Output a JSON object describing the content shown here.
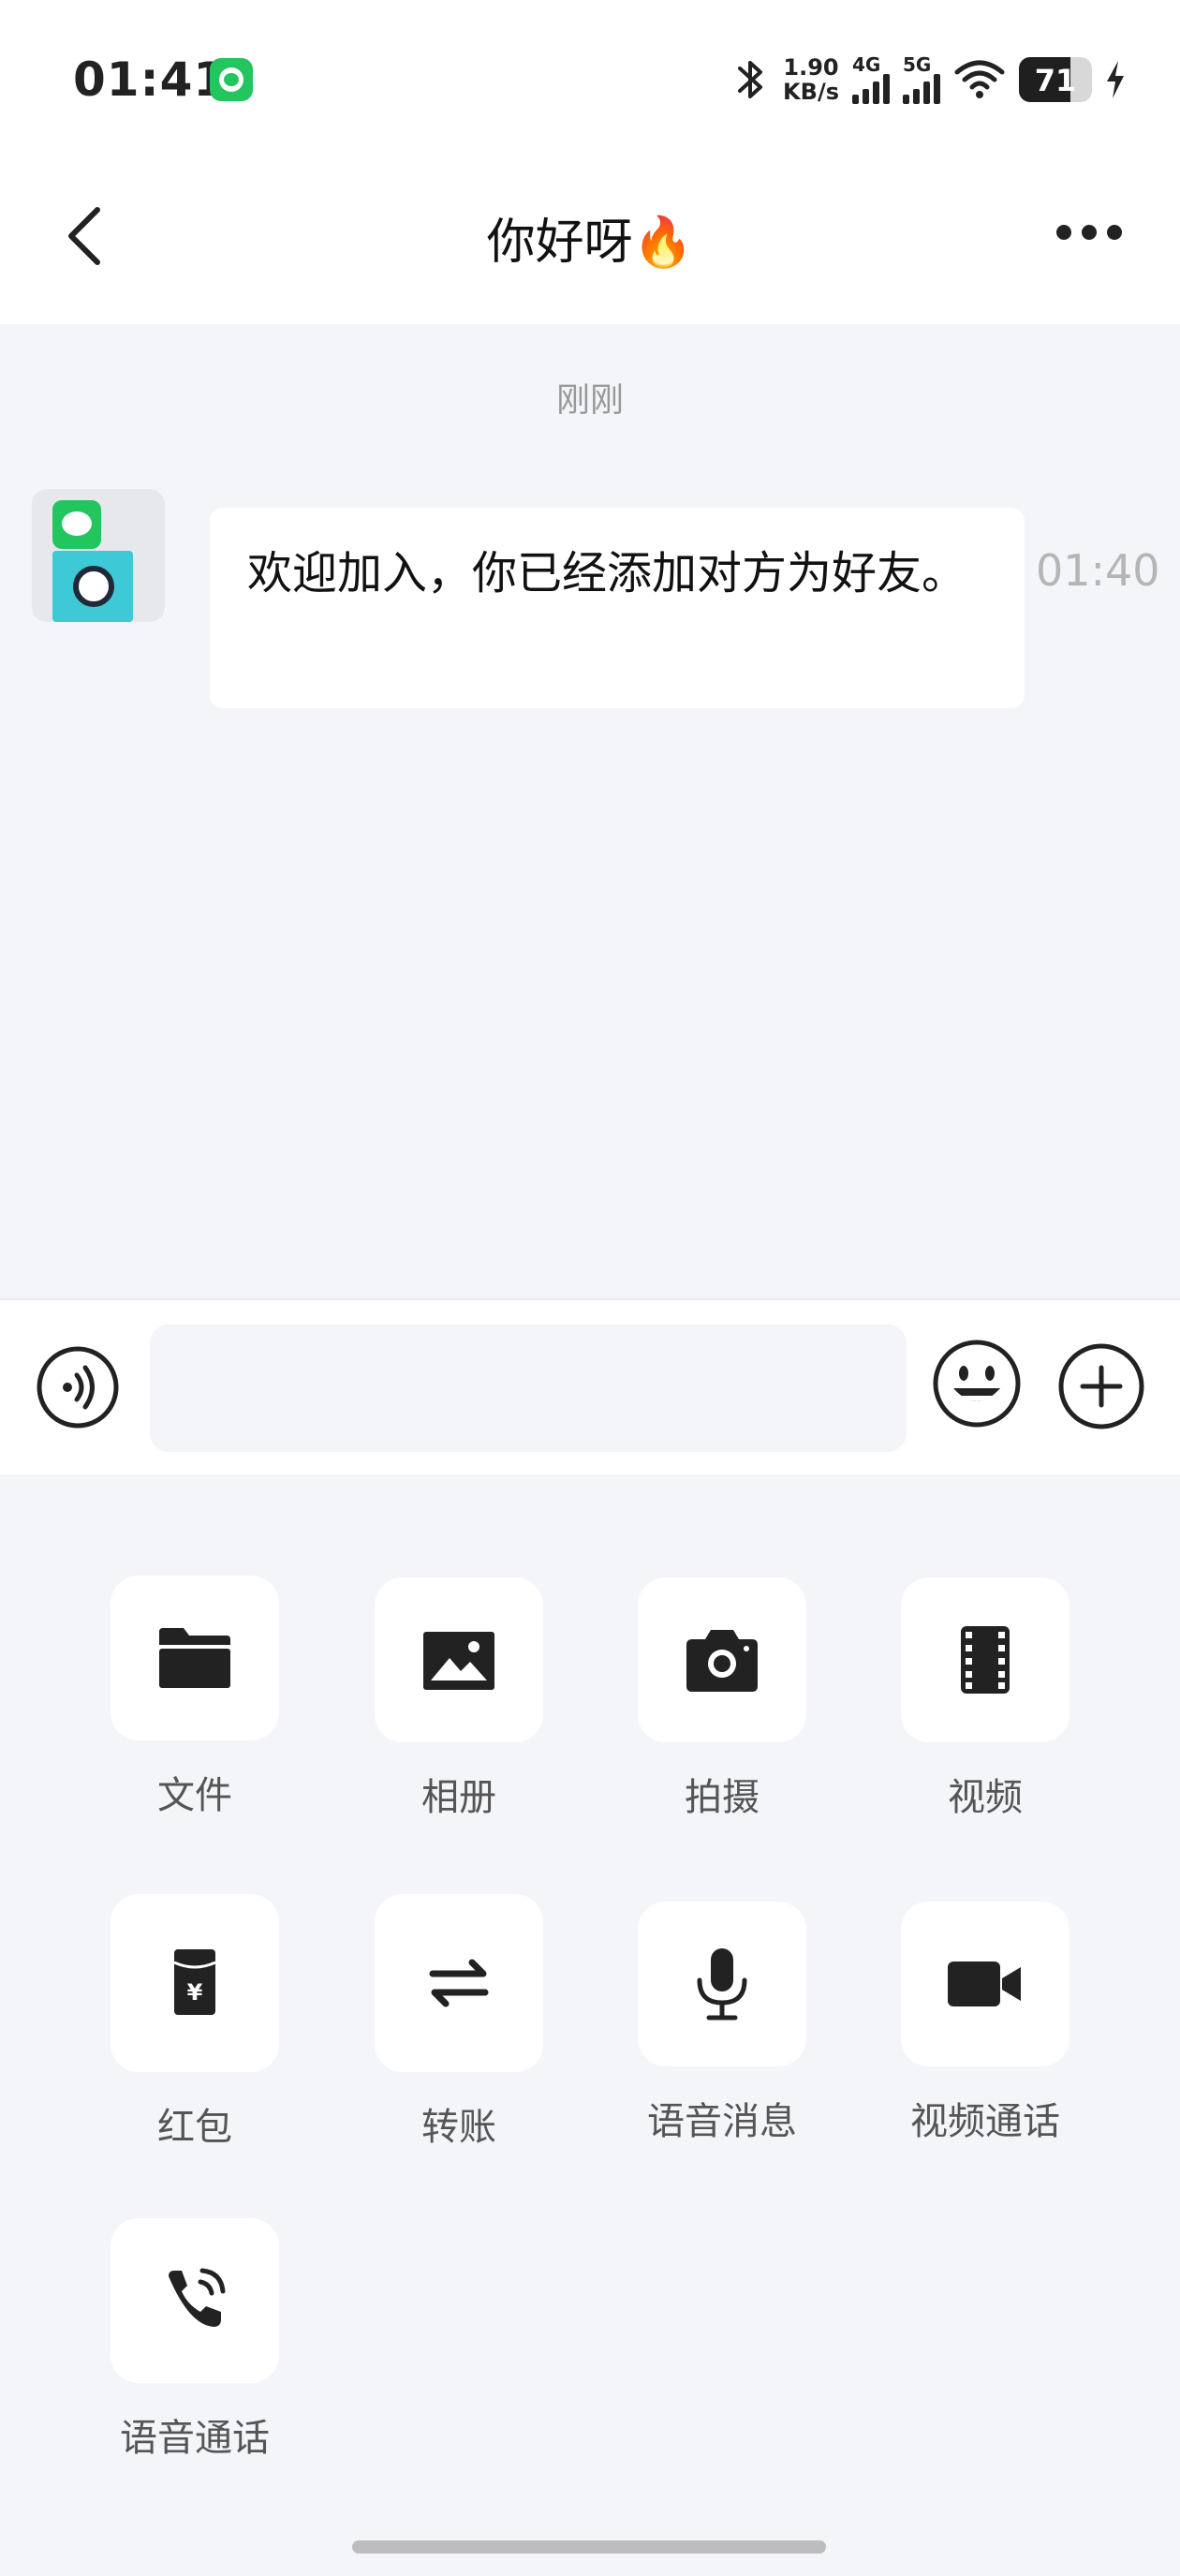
{
  "status_bar": {
    "time": "01:41",
    "net_speed_value": "1.90",
    "net_speed_unit": "KB/s",
    "signal_1_label": "4G",
    "signal_2_label": "5G",
    "battery_level": "71",
    "battery_fraction": 0.71,
    "icons": [
      "app-notification-icon",
      "bluetooth-icon",
      "signal-icon",
      "wifi-icon",
      "battery-icon",
      "charging-icon"
    ]
  },
  "header": {
    "title": "你好呀🔥",
    "icons": [
      "back-icon",
      "more-icon"
    ]
  },
  "chat": {
    "date_separator": "刚刚",
    "messages": [
      {
        "text": "欢迎加入，你已经添加对方为好友。",
        "time": "01:40"
      }
    ]
  },
  "input_bar": {
    "placeholder": "",
    "icons": [
      "voice-mode-icon",
      "emoji-icon",
      "plus-icon"
    ]
  },
  "tools_panel": {
    "items": [
      {
        "label": "文件",
        "icon": "folder-icon"
      },
      {
        "label": "相册",
        "icon": "image-icon"
      },
      {
        "label": "拍摄",
        "icon": "camera-icon"
      },
      {
        "label": "视频",
        "icon": "film-icon"
      },
      {
        "label": "红包",
        "icon": "red-packet-icon"
      },
      {
        "label": "转账",
        "icon": "transfer-icon"
      },
      {
        "label": "语音消息",
        "icon": "microphone-icon"
      },
      {
        "label": "视频通话",
        "icon": "video-camera-icon"
      },
      {
        "label": "语音通话",
        "icon": "phone-call-icon"
      }
    ]
  }
}
